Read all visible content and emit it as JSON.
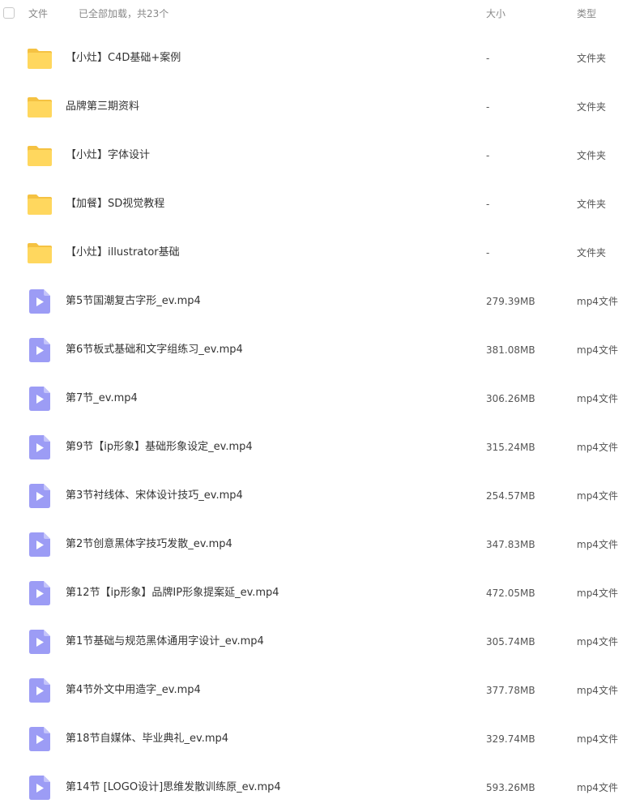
{
  "header": {
    "file_label": "文件",
    "loaded_status": "已全部加载，共23个",
    "size_label": "大小",
    "type_label": "类型"
  },
  "icons": {
    "folder": "folder-icon",
    "video": "video-file-icon"
  },
  "colors": {
    "folder_body": "#FFD75E",
    "folder_tab": "#F5C242",
    "video_body": "#9C9CF5",
    "video_play": "#FFFFFF"
  },
  "files": [
    {
      "name": "【小灶】C4D基础+案例",
      "size": "-",
      "type": "文件夹",
      "kind": "folder"
    },
    {
      "name": "品牌第三期资料",
      "size": "-",
      "type": "文件夹",
      "kind": "folder"
    },
    {
      "name": "【小灶】字体设计",
      "size": "-",
      "type": "文件夹",
      "kind": "folder"
    },
    {
      "name": "【加餐】SD视觉教程",
      "size": "-",
      "type": "文件夹",
      "kind": "folder"
    },
    {
      "name": "【小灶】illustrator基础",
      "size": "-",
      "type": "文件夹",
      "kind": "folder"
    },
    {
      "name": "第5节国潮复古字形_ev.mp4",
      "size": "279.39MB",
      "type": "mp4文件",
      "kind": "video"
    },
    {
      "name": "第6节板式基础和文字组练习_ev.mp4",
      "size": "381.08MB",
      "type": "mp4文件",
      "kind": "video"
    },
    {
      "name": "第7节_ev.mp4",
      "size": "306.26MB",
      "type": "mp4文件",
      "kind": "video"
    },
    {
      "name": "第9节【ip形象】基础形象设定_ev.mp4",
      "size": "315.24MB",
      "type": "mp4文件",
      "kind": "video"
    },
    {
      "name": "第3节衬线体、宋体设计技巧_ev.mp4",
      "size": "254.57MB",
      "type": "mp4文件",
      "kind": "video"
    },
    {
      "name": "第2节创意黑体字技巧发散_ev.mp4",
      "size": "347.83MB",
      "type": "mp4文件",
      "kind": "video"
    },
    {
      "name": "第12节【ip形象】品牌IP形象提案延_ev.mp4",
      "size": "472.05MB",
      "type": "mp4文件",
      "kind": "video"
    },
    {
      "name": "第1节基础与规范黑体通用字设计_ev.mp4",
      "size": "305.74MB",
      "type": "mp4文件",
      "kind": "video"
    },
    {
      "name": "第4节外文中用造字_ev.mp4",
      "size": "377.78MB",
      "type": "mp4文件",
      "kind": "video"
    },
    {
      "name": "第18节自媒体、毕业典礼_ev.mp4",
      "size": "329.74MB",
      "type": "mp4文件",
      "kind": "video"
    },
    {
      "name": "第14节 [LOGO设计]思维发散训练原_ev.mp4",
      "size": "593.26MB",
      "type": "mp4文件",
      "kind": "video"
    }
  ]
}
